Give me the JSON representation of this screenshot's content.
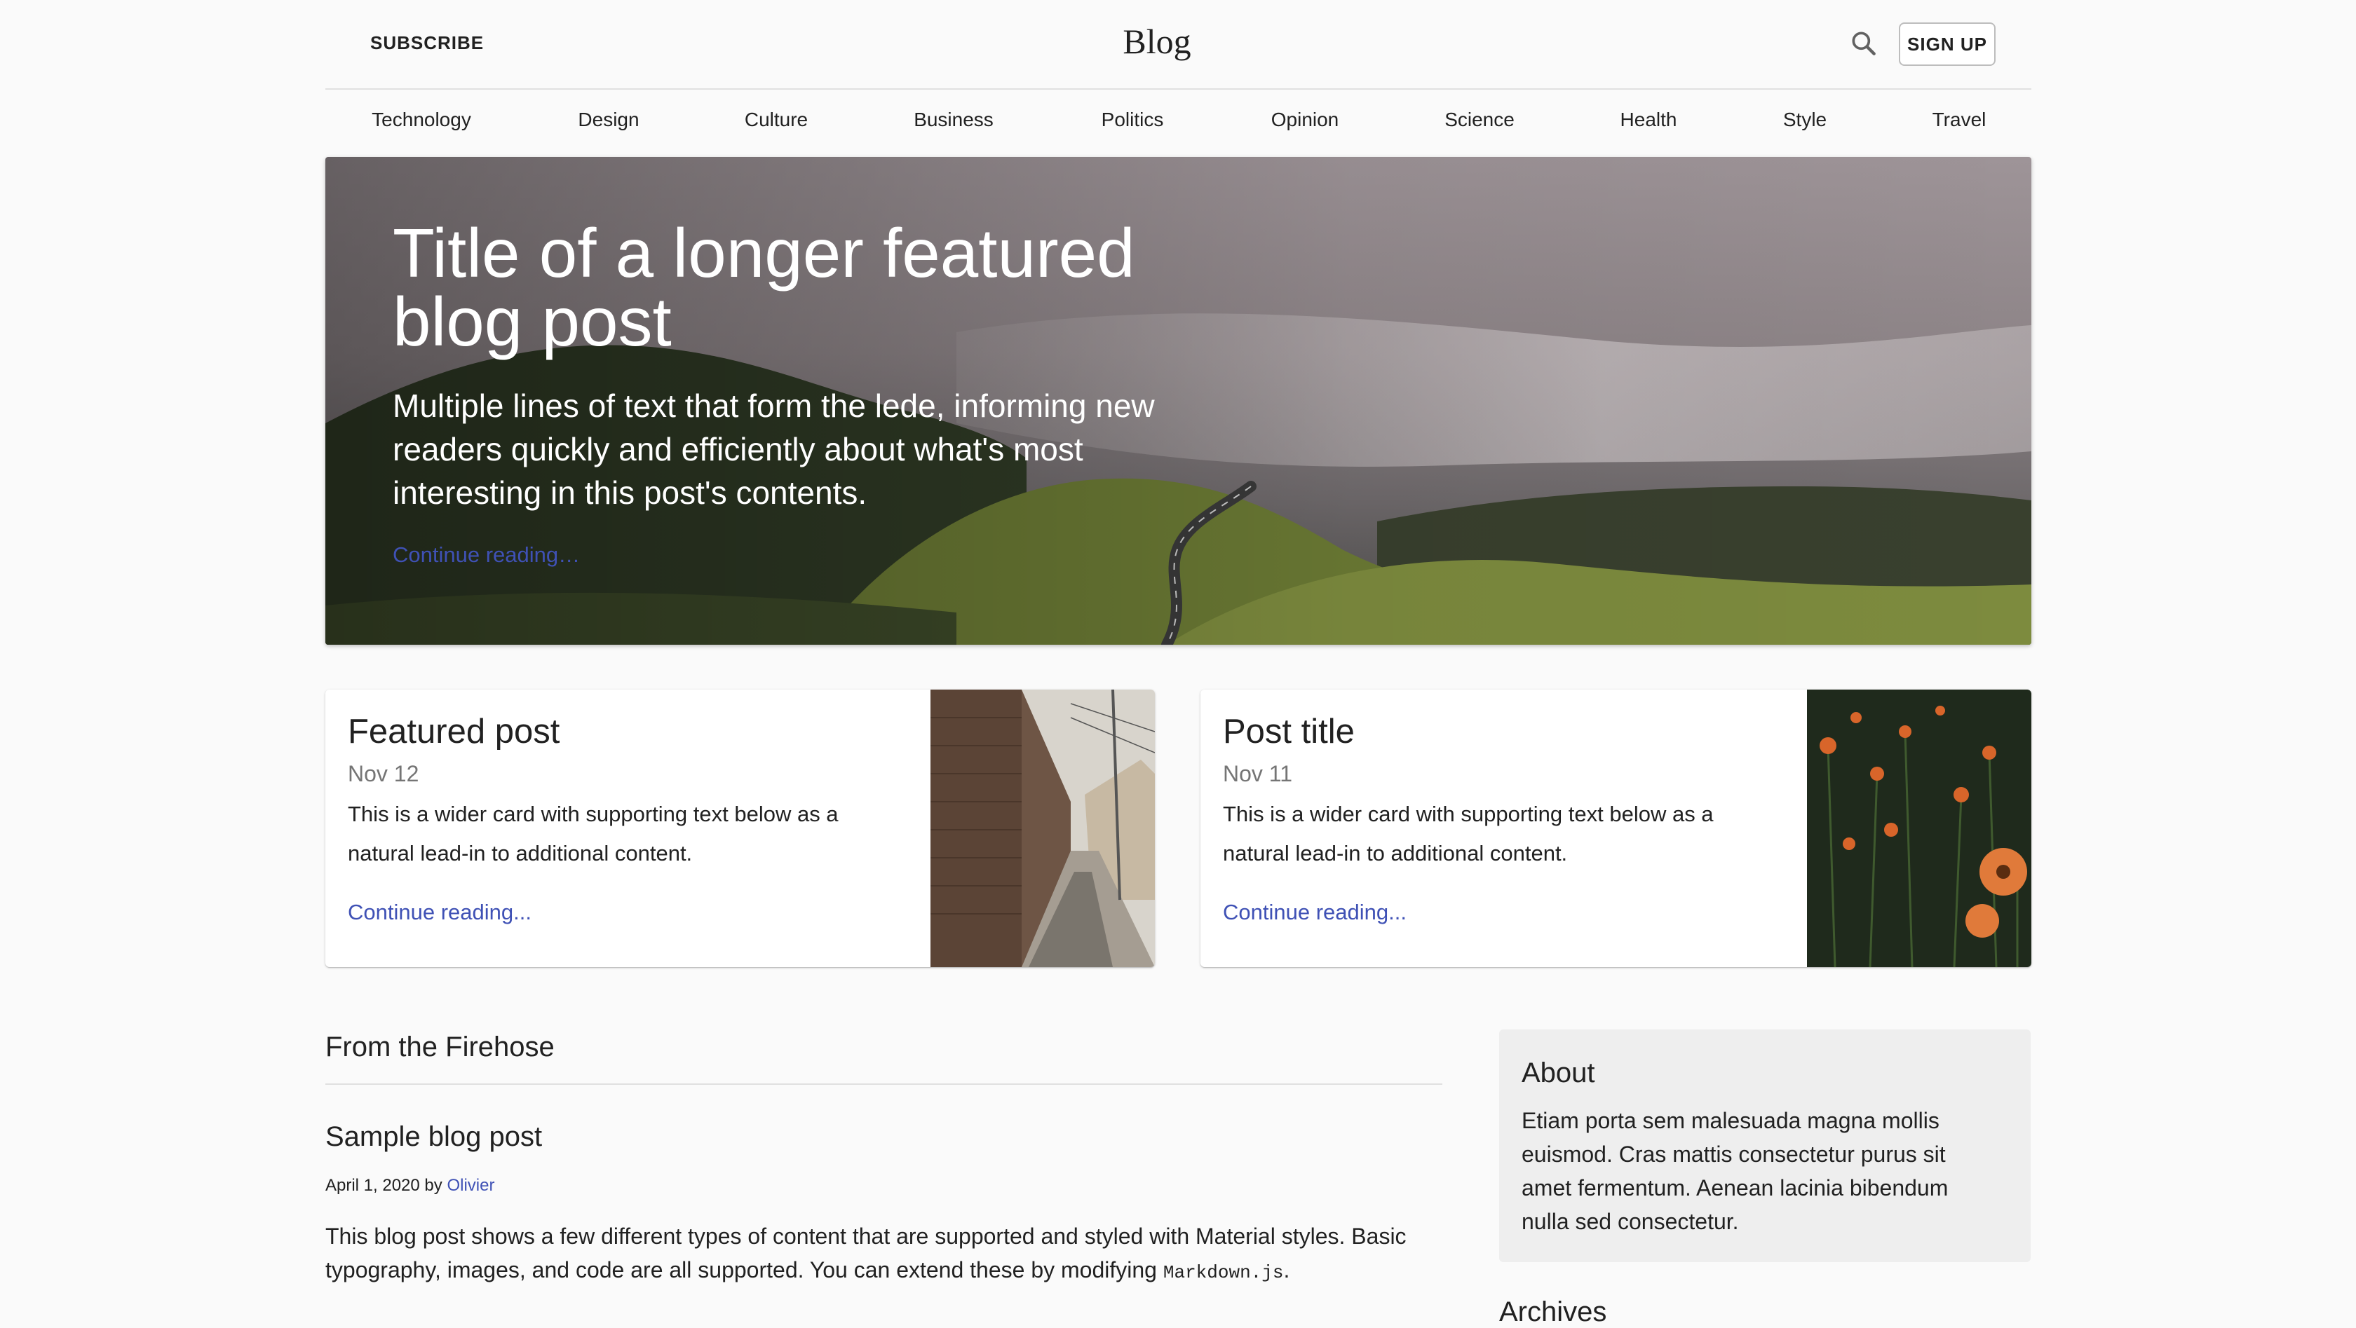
{
  "header": {
    "subscribe_label": "SUBSCRIBE",
    "title": "Blog",
    "search_icon": "search-icon",
    "signup_label": "SIGN UP"
  },
  "nav": {
    "items": [
      "Technology",
      "Design",
      "Culture",
      "Business",
      "Politics",
      "Opinion",
      "Science",
      "Health",
      "Style",
      "Travel"
    ]
  },
  "hero": {
    "title": "Title of a longer featured blog post",
    "lede": "Multiple lines of text that form the lede, informing new readers quickly and efficiently about what's most interesting in this post's contents.",
    "link": "Continue reading…"
  },
  "cards": [
    {
      "title": "Featured post",
      "date": "Nov 12",
      "text": "This is a wider card with supporting text below as a natural lead-in to additional content.",
      "link": "Continue reading..."
    },
    {
      "title": "Post title",
      "date": "Nov 11",
      "text": "This is a wider card with supporting text below as a natural lead-in to additional content.",
      "link": "Continue reading..."
    }
  ],
  "firehose": {
    "title": "From the Firehose",
    "post": {
      "title": "Sample blog post",
      "date": "April 1, 2020 by",
      "author": "Olivier",
      "body_part1": "This blog post shows a few different types of content that are supported and styled with Material styles. Basic typography, images, and code are all supported. You can extend these by modifying",
      "body_code": "Markdown.js",
      "body_part2": "."
    }
  },
  "sidebar": {
    "about_title": "About",
    "about_text": "Etiam porta sem malesuada magna mollis euismod. Cras mattis consectetur purus sit amet fermentum. Aenean lacinia bibendum nulla sed consectetur.",
    "archives_title": "Archives"
  },
  "colors": {
    "accent": "#3f51b5",
    "background": "#fafafa",
    "sidebar_bg": "#eeeeee"
  }
}
